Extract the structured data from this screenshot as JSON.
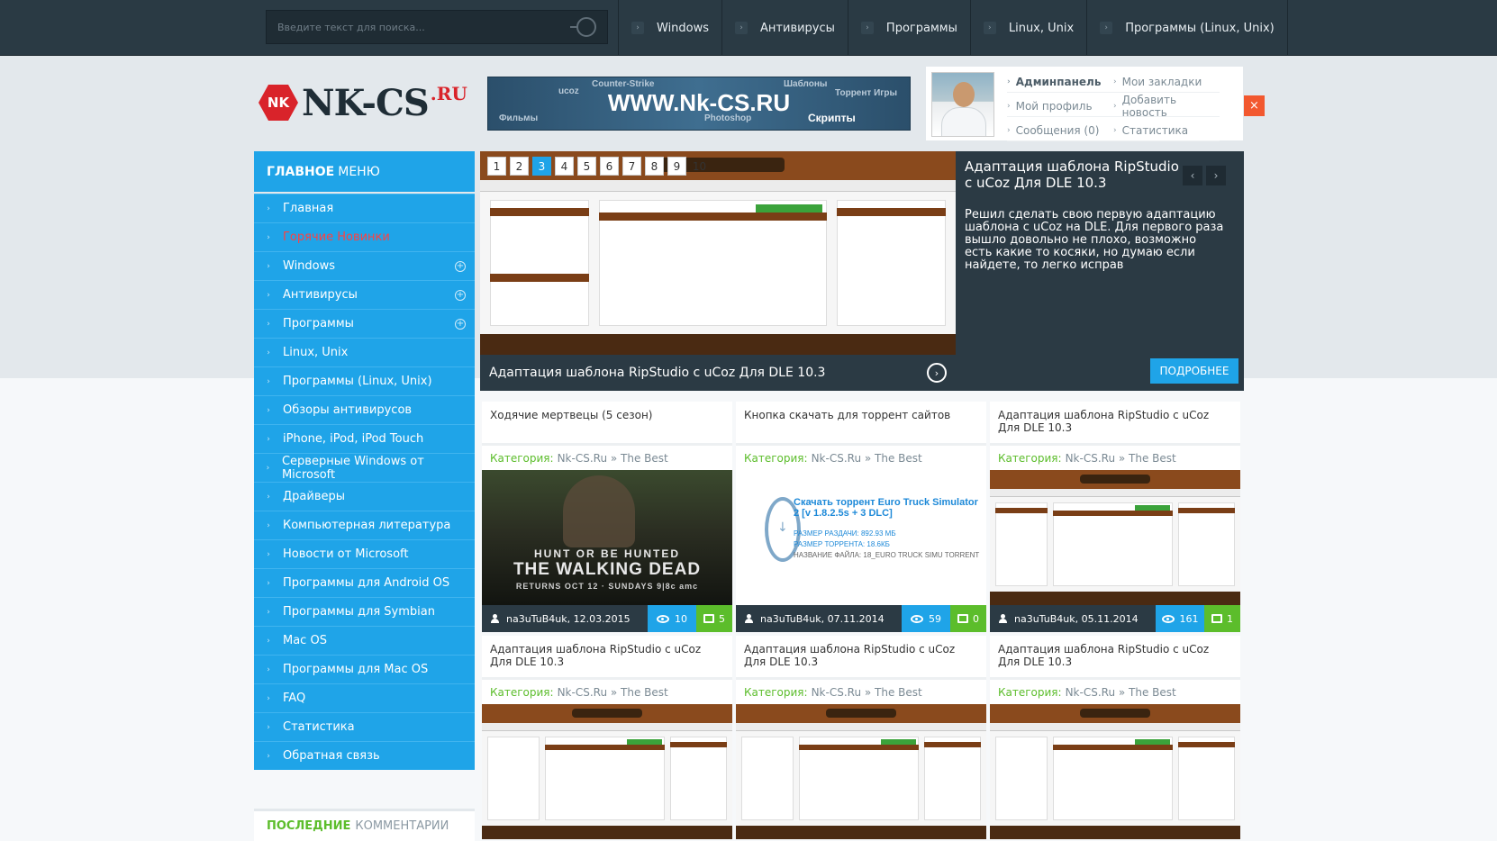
{
  "search": {
    "placeholder": "Введите текст для поиска..."
  },
  "topnav": [
    {
      "label": "Windows"
    },
    {
      "label": "Антивирусы"
    },
    {
      "label": "Программы"
    },
    {
      "label": "Linux, Unix"
    },
    {
      "label": "Программы (Linux, Unix)"
    }
  ],
  "logo": {
    "badge": "NK",
    "text": "NK-CS",
    "suffix": ".RU"
  },
  "banner": {
    "main": "WWW.Nk-CS.RU",
    "words": [
      "Counter-Strike",
      "ucoz",
      "Шаблоны",
      "Торрент Игры",
      "Фильмы",
      "Photoshop",
      "Скрипты"
    ]
  },
  "user_panel": {
    "links": [
      {
        "label": "Админпанель"
      },
      {
        "label": "Мои закладки"
      },
      {
        "label": "Мой профиль"
      },
      {
        "label": "Добавить новость"
      },
      {
        "label": "Сообщения (0)"
      },
      {
        "label": "Статистика"
      }
    ],
    "close": "×"
  },
  "sidebar": {
    "head_bold": "ГЛАВНОЕ",
    "head_rest": "МЕНЮ",
    "items": [
      {
        "label": "Главная"
      },
      {
        "label": "Горячие Новинки"
      },
      {
        "label": "Windows"
      },
      {
        "label": "Антивирусы"
      },
      {
        "label": "Программы"
      },
      {
        "label": "Linux, Unix"
      },
      {
        "label": "Программы (Linux, Unix)"
      },
      {
        "label": "Обзоры антивирусов"
      },
      {
        "label": "iPhone, iPod, iPod Touch"
      },
      {
        "label": "Серверные Windows от Microsoft"
      },
      {
        "label": "Драйверы"
      },
      {
        "label": "Компьютерная литература"
      },
      {
        "label": "Новости от Microsoft"
      },
      {
        "label": "Программы для Android OS"
      },
      {
        "label": "Программы для Symbian"
      },
      {
        "label": "Mac OS"
      },
      {
        "label": "Программы для Mac OS"
      },
      {
        "label": "FAQ"
      },
      {
        "label": "Статистика"
      },
      {
        "label": "Обратная связь"
      }
    ],
    "comments_bold": "ПОСЛЕДНИЕ",
    "comments_rest": "КОММЕНТАРИИ"
  },
  "slider": {
    "pages": [
      "1",
      "2",
      "3",
      "4",
      "5",
      "6",
      "7",
      "8",
      "9",
      "10"
    ],
    "caption": "Адаптация шаблона RipStudio с uCoz Для DLE 10.3",
    "title": "Адаптация шаблона RipStudio с uCoz Для DLE 10.3",
    "description": "Решил сделать свою первую адаптацию шаблона с uCoz на DLE. Для первого раза вышло довольно не плохо, возможно есть какие то косяки, но думаю если найдете, то легко исправ",
    "more": "ПОДРОБНЕЕ",
    "prev": "‹",
    "next": "›"
  },
  "cards": [
    {
      "title": "Ходячие мертвецы (5 сезон)",
      "cat_label": "Категория:",
      "cat": "Nk-CS.Ru » The Best",
      "author": "na3uTuB4uk, 12.03.2015",
      "views": "10",
      "comments": "5"
    },
    {
      "title": "Кнопка скачать для торрент сайтов",
      "cat_label": "Категория:",
      "cat": "Nk-CS.Ru » The Best",
      "author": "na3uTuB4uk, 07.11.2014",
      "views": "59",
      "comments": "0"
    },
    {
      "title": "Адаптация шаблона RipStudio с uCoz Для DLE 10.3",
      "cat_label": "Категория:",
      "cat": "Nk-CS.Ru » The Best",
      "author": "na3uTuB4uk, 05.11.2014",
      "views": "161",
      "comments": "1"
    },
    {
      "title": "Адаптация шаблона RipStudio с uCoz Для DLE 10.3",
      "cat_label": "Категория:",
      "cat": "Nk-CS.Ru » The Best"
    },
    {
      "title": "Адаптация шаблона RipStudio с uCoz Для DLE 10.3",
      "cat_label": "Категория:",
      "cat": "Nk-CS.Ru » The Best"
    },
    {
      "title": "Адаптация шаблона RipStudio с uCoz Для DLE 10.3",
      "cat_label": "Категория:",
      "cat": "Nk-CS.Ru » The Best"
    }
  ],
  "poster": {
    "line1": "HUNT OR BE HUNTED",
    "line2": "THE WALKING DEAD",
    "line3": "RETURNS OCT 12 · SUNDAYS 9|8c amc"
  },
  "torrent_promo": {
    "title": "Скачать торрент Euro Truck Simulator 2 [v 1.8.2.5s + 3 DLC]",
    "size_label": "РАЗМЕР РАЗДАЧИ: 892.93 МБ",
    "torrent_size": "РАЗМЕР ТОРРЕНТА: 18.6КБ",
    "file_name": "НАЗВАНИЕ ФАЙЛА: 18_EURO TRUCK SIMU TORRENT"
  }
}
